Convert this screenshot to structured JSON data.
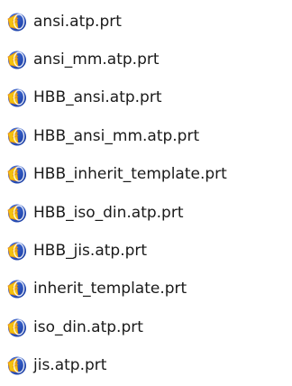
{
  "files": [
    {
      "name": "ansi.atp.prt",
      "icon": "prt-file-icon"
    },
    {
      "name": "ansi_mm.atp.prt",
      "icon": "prt-file-icon"
    },
    {
      "name": "HBB_ansi.atp.prt",
      "icon": "prt-file-icon"
    },
    {
      "name": "HBB_ansi_mm.atp.prt",
      "icon": "prt-file-icon"
    },
    {
      "name": "HBB_inherit_template.prt",
      "icon": "prt-file-icon"
    },
    {
      "name": "HBB_iso_din.atp.prt",
      "icon": "prt-file-icon"
    },
    {
      "name": "HBB_jis.atp.prt",
      "icon": "prt-file-icon"
    },
    {
      "name": "inherit_template.prt",
      "icon": "prt-file-icon"
    },
    {
      "name": "iso_din.atp.prt",
      "icon": "prt-file-icon"
    },
    {
      "name": "jis.atp.prt",
      "icon": "prt-file-icon"
    }
  ],
  "colors": {
    "icon_blue": "#2a56c6",
    "icon_dark_blue": "#12349a",
    "icon_yellow": "#f4c20d",
    "icon_orange": "#e38b1a",
    "text": "#1a1a1a"
  }
}
